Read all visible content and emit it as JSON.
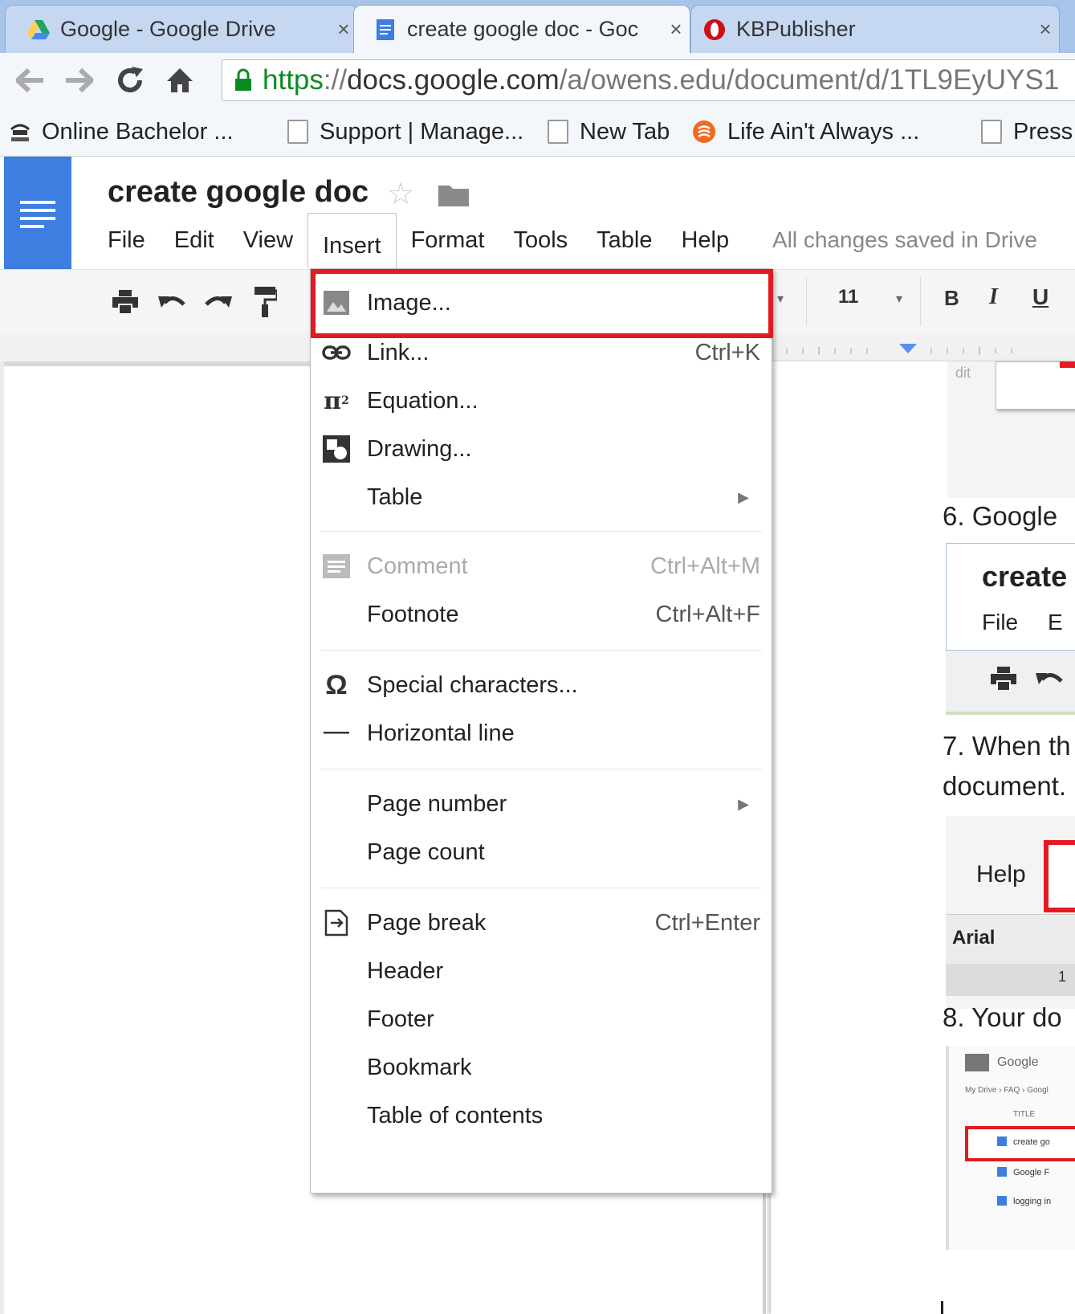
{
  "browser": {
    "tabs": [
      {
        "label": "Google - Google Drive",
        "icon": "drive-icon",
        "close": "×"
      },
      {
        "label": "create google doc - Goc",
        "icon": "docs-icon",
        "close": "×"
      },
      {
        "label": "KBPublisher",
        "icon": "opera-icon",
        "close": "×"
      }
    ],
    "url": {
      "scheme": "https",
      "sep": "://",
      "host": "docs.google.com",
      "path": "/a/owens.edu/document/d/1TL9EyUYS1"
    },
    "bookmarks": [
      {
        "label": "Online Bachelor ...",
        "icon": "owens-logo-icon"
      },
      {
        "label": "Support | Manage...",
        "icon": "page-icon"
      },
      {
        "label": "New Tab",
        "icon": "page-icon"
      },
      {
        "label": "Life Ain't Always ...",
        "icon": "rss-icon"
      },
      {
        "label": "Press",
        "icon": "page-icon"
      }
    ]
  },
  "doc": {
    "title": "create google doc",
    "menus": [
      "File",
      "Edit",
      "View",
      "Insert",
      "Format",
      "Tools",
      "Table",
      "Help"
    ],
    "saved_status": "All changes saved in Drive",
    "font_size": "11",
    "bold": "B",
    "italic": "I",
    "underline": "U"
  },
  "insert_menu": {
    "items": [
      {
        "label": "Image...",
        "shortcut": "",
        "icon": "image-icon"
      },
      {
        "label": "Link...",
        "shortcut": "Ctrl+K",
        "icon": "link-icon"
      },
      {
        "label": "Equation...",
        "shortcut": "",
        "icon": "pi-icon"
      },
      {
        "label": "Drawing...",
        "shortcut": "",
        "icon": "drawing-icon"
      },
      {
        "label": "Table",
        "shortcut": "",
        "icon": "",
        "submenu": true
      },
      {
        "label": "Comment",
        "shortcut": "Ctrl+Alt+M",
        "icon": "comment-icon",
        "disabled": true
      },
      {
        "label": "Footnote",
        "shortcut": "Ctrl+Alt+F",
        "icon": ""
      },
      {
        "label": "Special characters...",
        "shortcut": "",
        "icon": "omega-icon"
      },
      {
        "label": "Horizontal line",
        "shortcut": "",
        "icon": "horizontal-line-icon"
      },
      {
        "label": "Page number",
        "shortcut": "",
        "icon": "",
        "submenu": true
      },
      {
        "label": "Page count",
        "shortcut": "",
        "icon": ""
      },
      {
        "label": "Page break",
        "shortcut": "Ctrl+Enter",
        "icon": "page-break-icon"
      },
      {
        "label": "Header",
        "shortcut": "",
        "icon": ""
      },
      {
        "label": "Footer",
        "shortcut": "",
        "icon": ""
      },
      {
        "label": "Bookmark",
        "shortcut": "",
        "icon": ""
      },
      {
        "label": "Table of contents",
        "shortcut": "",
        "icon": ""
      }
    ],
    "highlight_color": "#e21a22"
  },
  "page_content": {
    "step6": "6.  Google",
    "thumb6_title": "create",
    "thumb6_file": "File",
    "thumb6_edit": "E",
    "step7_line1": "7.  When th",
    "step7_line2": "document.",
    "thumb7_help": "Help",
    "thumb7_font": "Arial",
    "thumb7_num": "1",
    "step8": "8.  Your do",
    "thumb8_google": "Google",
    "thumb8_breadcrumb": "My Drive  ›  FAQ  ›  Googl",
    "thumb8_col": "TITLE",
    "thumb8_rows": [
      "create go",
      "Google F",
      "logging in"
    ],
    "thumb5_text": "dit"
  },
  "colors": {
    "docs_blue": "#3d7ee0",
    "tab_strip": "#a9c4ea",
    "secure_green": "#0a8b22"
  }
}
